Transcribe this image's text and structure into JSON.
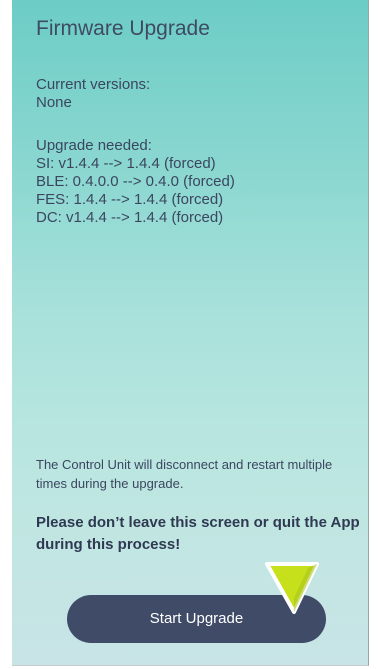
{
  "screen": {
    "title": "Firmware Upgrade",
    "current_versions": {
      "heading": "Current versions:",
      "value": "None"
    },
    "upgrade_needed": {
      "heading": "Upgrade needed:",
      "items": [
        "SI: v1.4.4 --> 1.4.4 (forced)",
        "BLE: 0.4.0.0 --> 0.4.0 (forced)",
        "FES: 1.4.4 --> 1.4.4 (forced)",
        "DC: v1.4.4 --> 1.4.4 (forced)"
      ]
    },
    "note": "The Control Unit will disconnect and restart multiple times during the upgrade.",
    "warning": "Please don’t leave this screen or quit the App during this process!",
    "start_button_label": "Start Upgrade"
  },
  "colors": {
    "gradient_top": "#6ccdc6",
    "gradient_bottom": "#c8e4e6",
    "text": "#3b4660",
    "button": "#3f4b67",
    "button_text": "#ffffff",
    "pointer_fill": "#c6e01c",
    "pointer_stroke": "#ffffff"
  },
  "icons": {
    "pointer": "triangle-pointer-icon"
  }
}
